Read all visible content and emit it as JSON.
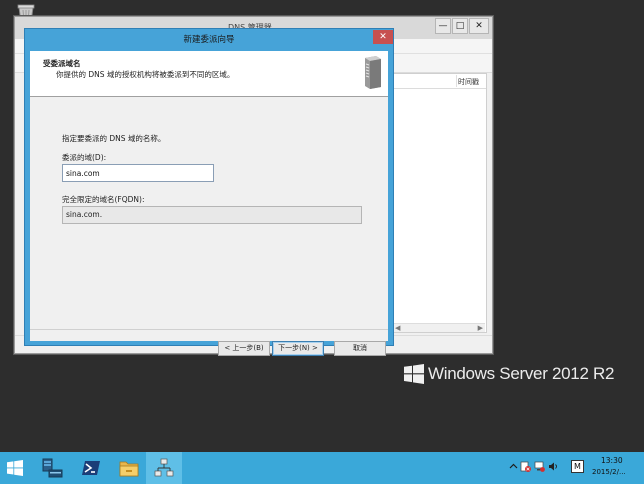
{
  "dns_window": {
    "title": "DNS 管理器",
    "list_column_time": "时间戳"
  },
  "wizard": {
    "title": "新建委派向导",
    "header_title": "受委派域名",
    "header_subtitle": "你提供的 DNS 域的授权机构将被委派到不同的区域。",
    "description": "指定要委派的 DNS 域的名称。",
    "delegated_domain_label": "委派的域(D):",
    "delegated_domain_value": "sina.com",
    "fqdn_label": "完全限定的域名(FQDN):",
    "fqdn_value": "sina.com.",
    "back_button": "< 上一步(B)",
    "next_button": "下一步(N) >",
    "cancel_button": "取消"
  },
  "branding": {
    "text": "Windows Server 2012 R2"
  },
  "taskbar": {
    "ime": "M",
    "time": "13:30",
    "date": "2015/2/..."
  },
  "icons": [
    "recycle-bin-icon",
    "server-manager-icon",
    "powershell-icon",
    "file-explorer-icon",
    "dns-manager-icon",
    "windows-logo-icon",
    "server-tower-icon"
  ],
  "colors": {
    "desktop": "#2d2d2d",
    "taskbar": "#3aa8d9",
    "dialog_frame": "#46a3d8",
    "close_button": "#c75050"
  }
}
